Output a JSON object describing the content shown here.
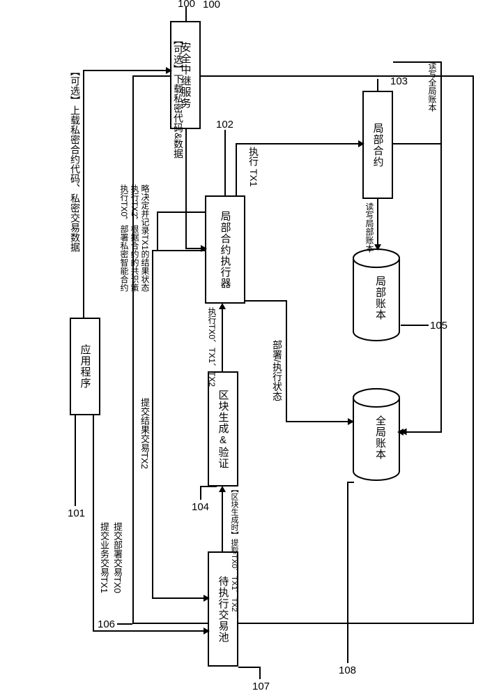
{
  "nodes": {
    "relay": {
      "label": "安全中继服务",
      "ref": "100"
    },
    "app": {
      "label": "应用程序",
      "ref": "101"
    },
    "executor": {
      "label": "局部合约执行器",
      "ref": "102"
    },
    "local_sc": {
      "label": "局部合约",
      "ref": "103"
    },
    "blockgen": {
      "label": "区块生成&验证",
      "ref": "104"
    },
    "local_ledger": {
      "label": "局部账本",
      "ref": "105"
    },
    "global_ledger": {
      "label": "全局账本",
      "ref": "108"
    },
    "txpool": {
      "label": "待执行交易池",
      "ref": "107"
    },
    "node_frame": {
      "ref": "106"
    }
  },
  "edges": {
    "upload": "【可选】上载私密合约代码、私密交易数据",
    "download": "【可选】下载私密代码&数据",
    "exec_tx1": "执行 TX1",
    "rw_local": "读写局部账本",
    "rw_global": "读写全局账本",
    "deploy_state": "部署/执行状态",
    "exec_all": "执行TX0、TX1、TX2",
    "submit_result": "提交结果交易TX2",
    "extract": "【区块生成时】提取TX0、TX1、TX2",
    "app_submit": "提交部署交易TX0\n提交业务交易TX1",
    "exec_steps_1": "执行TX0，部署私密智能合约",
    "exec_steps_2": "执行TX2，根据合约的共识策",
    "exec_steps_3": "略决定并记录TX1的结果状态"
  }
}
